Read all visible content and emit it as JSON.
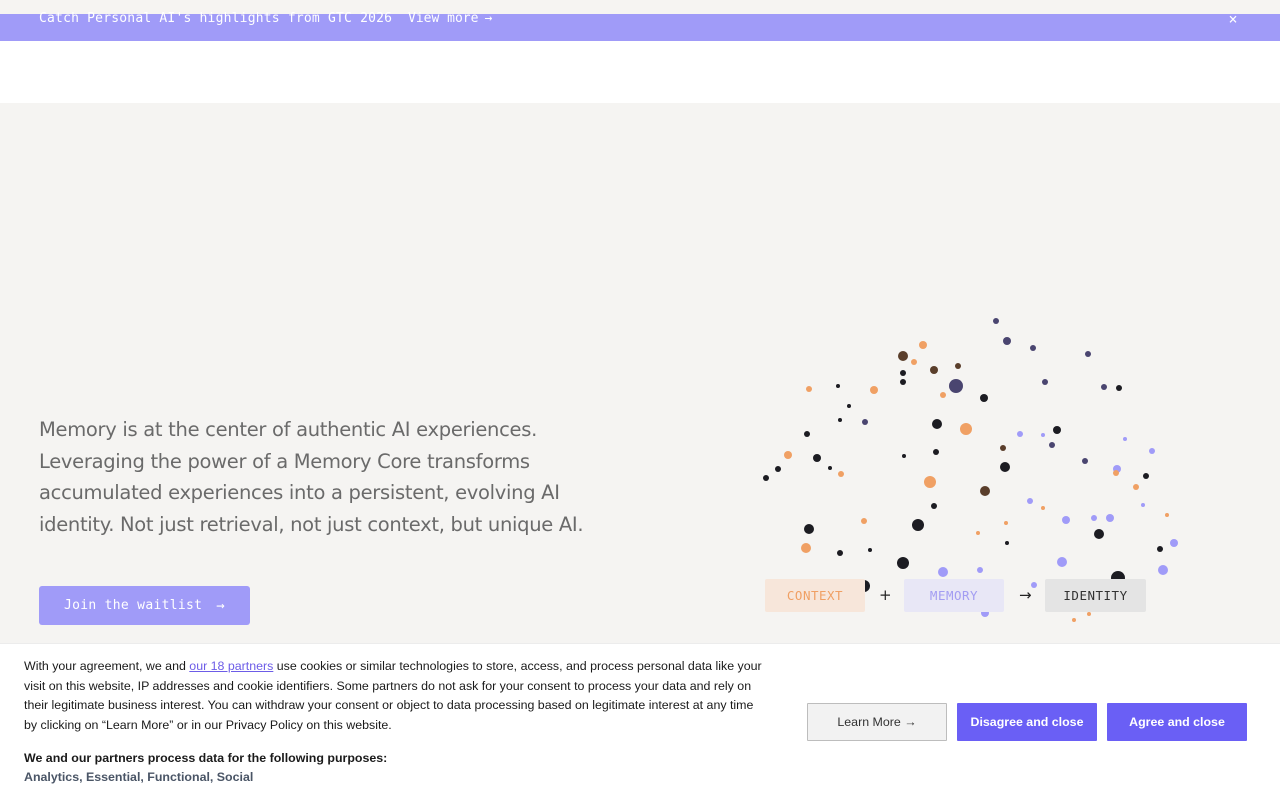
{
  "banner": {
    "text": "Catch Personal AI's highlights from GTC 2026",
    "link_label": "View more",
    "link_arrow": "→",
    "close_icon": "×"
  },
  "hero": {
    "description": "Memory is at the center of authentic AI experiences. Leveraging the power of a Memory Core transforms accumulated experiences into a persistent, evolving AI identity. Not just retrieval, not just context, but unique AI.",
    "cta_label": "Join the waitlist",
    "cta_arrow": "→",
    "equation": {
      "context": "CONTEXT",
      "plus": "+",
      "memory": "MEMORY",
      "arrow": "→",
      "identity": "IDENTITY"
    },
    "colors": {
      "accent": "#a09bf8",
      "orange": "#f0a064",
      "dark": "#1c1c22",
      "navy": "#4a4570"
    }
  },
  "consent": {
    "text_before_link": "With your agreement, we and ",
    "partners_link": "our 18 partners",
    "text_after_link": " use cookies or similar technologies to store, access, and process personal data like your visit on this website, IP addresses and cookie identifiers. Some partners do not ask for your consent to process your data and rely on their legitimate business interest. You can withdraw your consent or object to data processing based on legitimate interest at any time by clicking on “Learn More” or in our Privacy Policy on this website.",
    "purposes_title": "We and our partners process data for the following purposes:",
    "purposes": "Analytics, Essential, Functional, Social",
    "learn_more": "Learn More →",
    "disagree": "Disagree and close",
    "agree": "Agree and close"
  }
}
